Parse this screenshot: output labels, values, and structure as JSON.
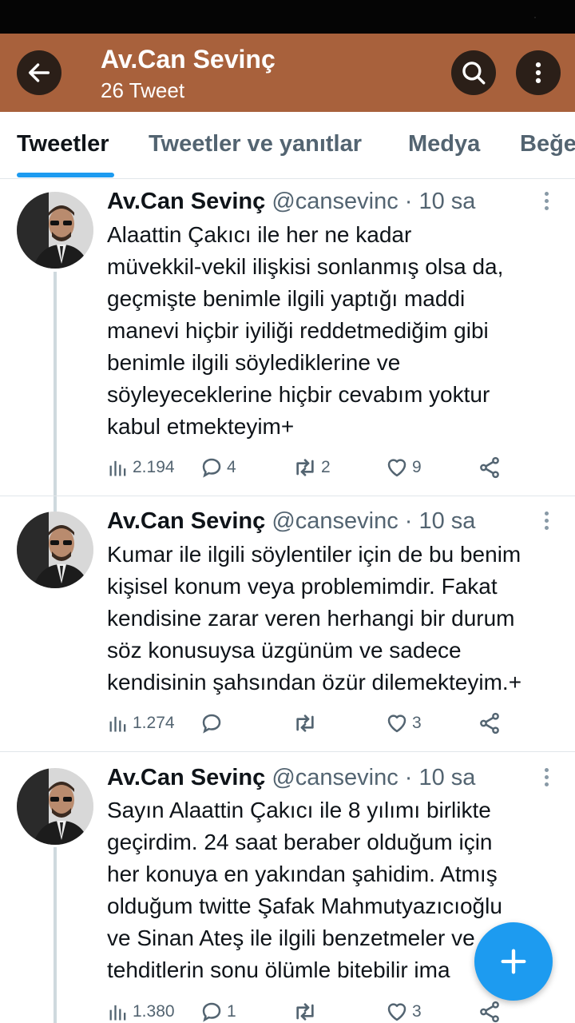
{
  "header": {
    "title": "Av.Can Sevinç",
    "subtitle": "26 Tweet",
    "bg_color": "#a8613c"
  },
  "tabs": [
    {
      "label": "Tweetler",
      "active": true
    },
    {
      "label": "Tweetler ve yanıtlar",
      "active": false
    },
    {
      "label": "Medya",
      "active": false
    },
    {
      "label": "Beğe",
      "active": false
    }
  ],
  "tweets": [
    {
      "author": "Av.Can Sevinç",
      "handle": "@cansevinc",
      "time": "· 10 sa",
      "text": "Alaattin Çakıcı ile her ne kadar\nmüvekkil-vekil ilişkisi sonlanmış olsa da,\ngeçmişte benimle ilgili yaptığı maddi\nmanevi hiçbir iyiliği reddetmediğim gibi\nbenimle ilgili söylediklerine ve\nsöyleyeceklerine hiçbir cevabım yoktur\nkabul etmekteyim+",
      "views": "2.194",
      "replies": "4",
      "retweets": "2",
      "likes": "9"
    },
    {
      "author": "Av.Can Sevinç",
      "handle": "@cansevinc",
      "time": "· 10 sa",
      "text": "Kumar ile ilgili söylentiler için de bu benim\nkişisel konum veya problemimdir. Fakat\nkendisine zarar veren herhangi bir durum\nsöz konusuysa üzgünüm ve sadece\nkendisinin şahsından özür dilemekteyim.+",
      "views": "1.274",
      "replies": "",
      "retweets": "",
      "likes": "3"
    },
    {
      "author": "Av.Can Sevinç",
      "handle": "@cansevinc",
      "time": "· 10 sa",
      "text": "Sayın Alaattin Çakıcı ile 8 yılımı birlikte\ngeçirdim. 24 saat beraber olduğum için\nher konuya en yakından şahidim. Atmış\nolduğum twitte Şafak Mahmutyazıcıoğlu\nve Sinan Ateş ile ilgili benzetmeler ve\ntehditlerin sonu ölümle bitebilir ima",
      "views": "1.380",
      "replies": "1",
      "retweets": "",
      "likes": "3"
    }
  ],
  "icons": {
    "back": "arrow-left-icon",
    "search": "search-icon",
    "more": "more-vertical-icon",
    "views": "bar-chart-icon",
    "reply": "speech-bubble-icon",
    "retweet": "retweet-icon",
    "like": "heart-icon",
    "share": "share-icon",
    "compose": "plus-icon"
  },
  "colors": {
    "accent": "#1d9bf0",
    "text_secondary": "#536471"
  }
}
